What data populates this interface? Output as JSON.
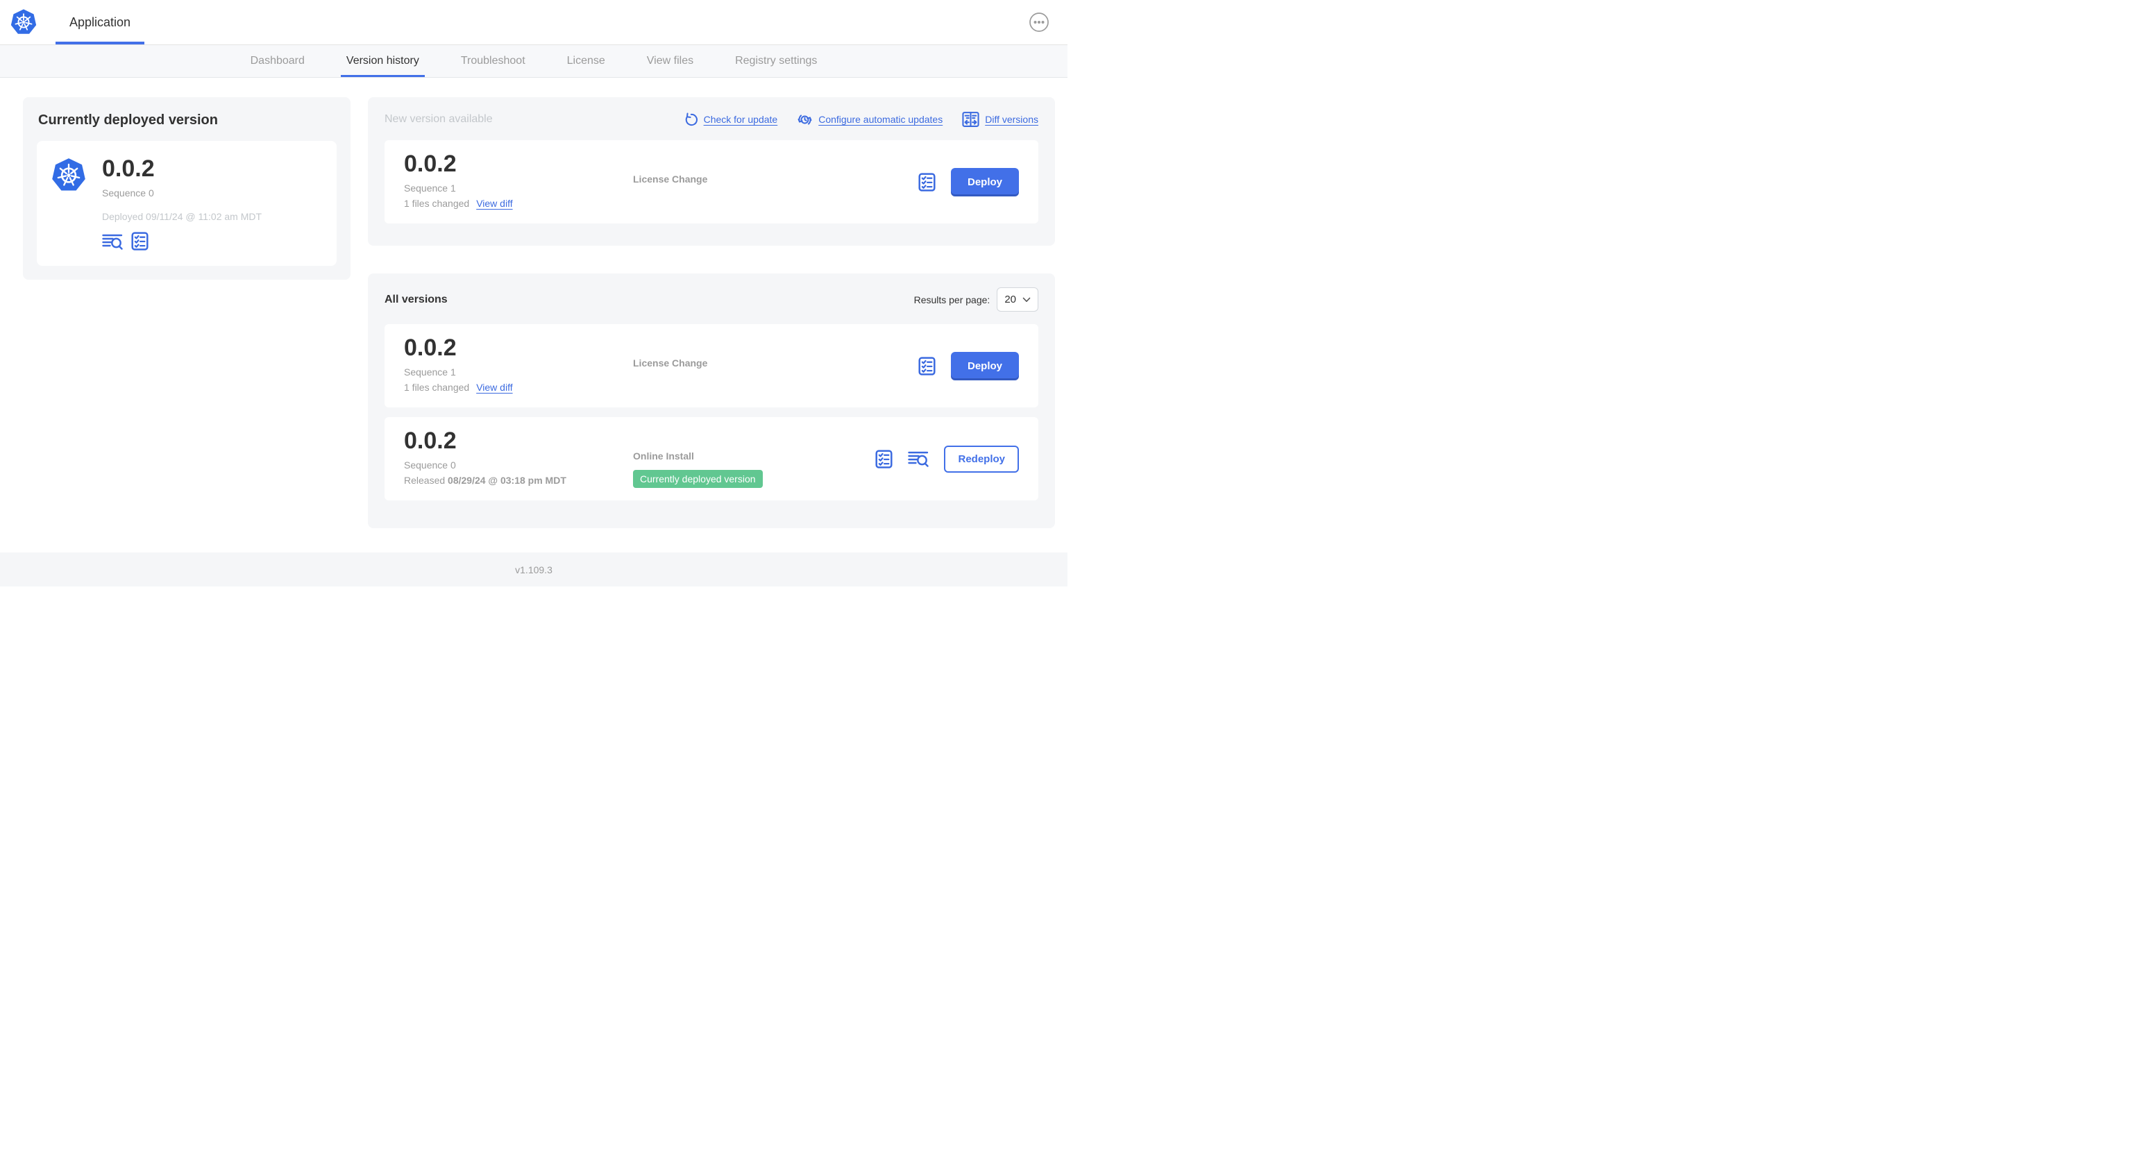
{
  "colors": {
    "accent_blue": "#3b6ae0",
    "primary_button_blue": "#4270e8",
    "kubernetes_blue": "#326ce5",
    "badge_green": "#61c791",
    "dark_text": "#323232",
    "gray_text": "#9b9b9b",
    "light_gray_text": "#c3c7cb",
    "panel_bg": "#f5f6f8"
  },
  "topbar": {
    "app_tab": "Application"
  },
  "nav": {
    "active_tab": "Version history",
    "tabs": [
      {
        "label": "Dashboard"
      },
      {
        "label": "Version history"
      },
      {
        "label": "Troubleshoot"
      },
      {
        "label": "License"
      },
      {
        "label": "View files"
      },
      {
        "label": "Registry settings"
      }
    ]
  },
  "current_version": {
    "heading": "Currently deployed version",
    "version": "0.0.2",
    "sequence": "Sequence 0",
    "deployed": "Deployed 09/11/24 @ 11:02 am MDT"
  },
  "new_version": {
    "heading": "New version available",
    "actions": {
      "check_for_update": "Check for update",
      "configure_automatic_updates": "Configure automatic updates",
      "diff_versions": "Diff versions"
    },
    "card": {
      "version": "0.0.2",
      "sequence": "Sequence 1",
      "files_changed": "1 files changed",
      "view_diff": "View diff",
      "source": "License Change",
      "action": "Deploy"
    }
  },
  "all_versions": {
    "heading": "All versions",
    "results_per_page_label": "Results per page:",
    "results_per_page_value": "20",
    "rows": [
      {
        "version": "0.0.2",
        "sequence": "Sequence 1",
        "files_changed": "1 files changed",
        "view_diff": "View diff",
        "source": "License Change",
        "action": "Deploy"
      },
      {
        "version": "0.0.2",
        "sequence": "Sequence 0",
        "released_label": "Released",
        "released_date": "08/29/24 @ 03:18 pm MDT",
        "source": "Online Install",
        "badge": "Currently deployed version",
        "action": "Redeploy"
      }
    ]
  },
  "footer": {
    "version": "v1.109.3"
  }
}
